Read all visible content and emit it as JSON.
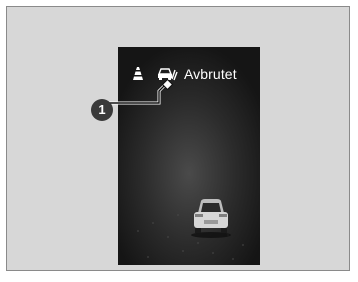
{
  "display": {
    "status_text": "Avbrutet",
    "lane_icon": "lane-marker-icon",
    "lkas_icon": "lane-keeping-assist-icon",
    "vehicle_icon": "vehicle-rear-icon"
  },
  "callout": {
    "number": "1"
  },
  "colors": {
    "frame_background": "#d7d7d7",
    "screen_background": "#1f1f1f",
    "text": "#ffffff",
    "callout_badge": "#3a3a3a"
  }
}
